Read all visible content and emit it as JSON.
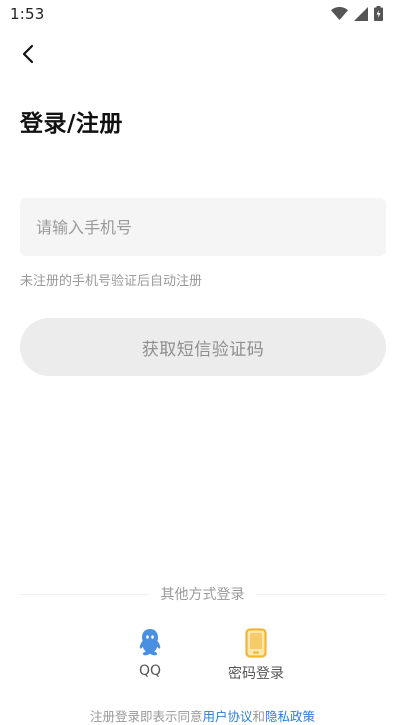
{
  "status_bar": {
    "time": "1:53"
  },
  "header": {
    "title": "登录/注册"
  },
  "phone": {
    "placeholder": "请输入手机号",
    "value": "",
    "hint": "未注册的手机号验证后自动注册"
  },
  "sms_button": {
    "label": "获取短信验证码"
  },
  "other_login": {
    "label": "其他方式登录",
    "options": [
      {
        "label": "QQ",
        "icon": "qq-icon",
        "color": "#4a90e2"
      },
      {
        "label": "密码登录",
        "icon": "phone-icon",
        "color": "#f2b632"
      }
    ]
  },
  "agreement": {
    "prefix": "注册登录即表示同意",
    "user_agreement": "用户协议",
    "conjunction": "和",
    "privacy_policy": "隐私政策",
    "link_color": "#2f7bd8"
  }
}
